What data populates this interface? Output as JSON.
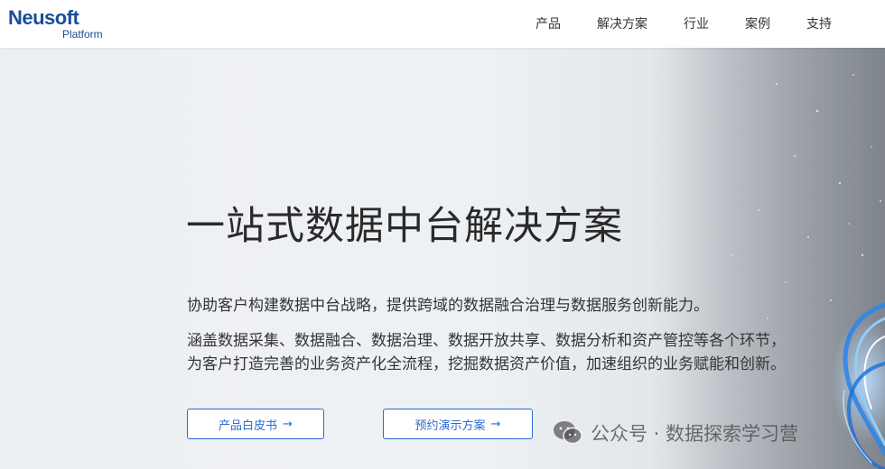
{
  "brand": {
    "name": "Neusoft",
    "sub": "Platform",
    "color": "#1a4e98"
  },
  "nav": {
    "items": [
      {
        "label": "产品"
      },
      {
        "label": "解决方案"
      },
      {
        "label": "行业"
      },
      {
        "label": "案例"
      },
      {
        "label": "支持"
      }
    ]
  },
  "hero": {
    "title": "一站式数据中台解决方案",
    "desc1": "协助客户构建数据中台战略，提供跨域的数据融合治理与数据服务创新能力。",
    "desc2": "涵盖数据采集、数据融合、数据治理、数据开放共享、数据分析和资产管控等各个环节，",
    "desc3": "为客户打造完善的业务资产化全流程，挖掘数据资产价值，加速组织的业务赋能和创新。",
    "buttons": {
      "whitepaper_label": "产品白皮书",
      "demo_label": "预约演示方案",
      "accent": "#2d6bd0"
    },
    "art_icon": "light-swirl"
  },
  "watermark": {
    "icon": "wechat-icon",
    "text": "公众号 · 数据探索学习营"
  }
}
